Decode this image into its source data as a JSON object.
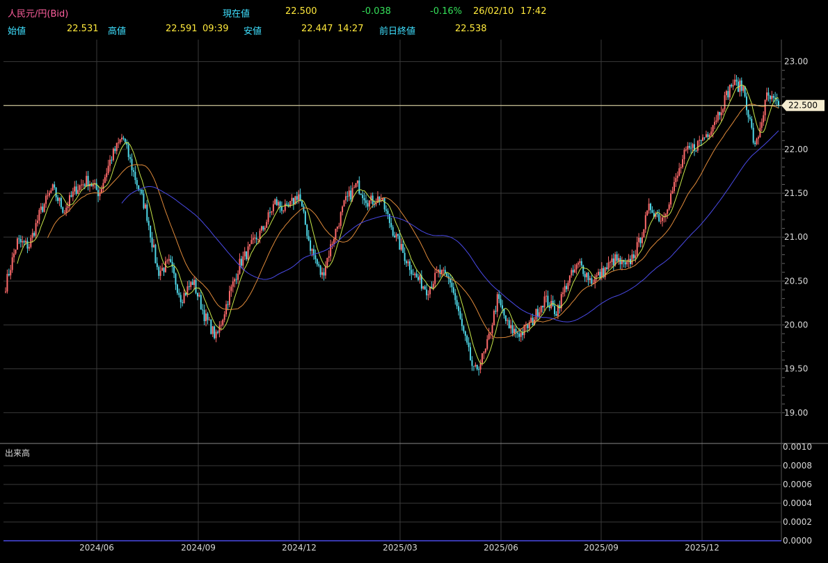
{
  "header": {
    "symbol": "人民元/円(Bid)",
    "current_label": "現在値",
    "current_value": "22.500",
    "change": "-0.038",
    "change_pct": "-0.16%",
    "date": "26/02/10",
    "time": "17:42",
    "open_label": "始値",
    "open_value": "22.531",
    "high_label": "高値",
    "high_value": "22.591",
    "high_time": "09:39",
    "low_label": "安値",
    "low_value": "22.447",
    "low_time": "14:27",
    "prev_close_label": "前日終値",
    "prev_close_value": "22.538"
  },
  "colors": {
    "background": "#000000",
    "grid": "#3a3a3a",
    "up_candle": "#ff6b6b",
    "down_candle": "#4fd8e8",
    "ma_short": "#c8e84a",
    "ma_mid": "#e08a3a",
    "ma_long": "#4a4ae8",
    "price_line": "#f0e6b0"
  },
  "chart_data": {
    "type": "candlestick",
    "price_axis": {
      "ticks": [
        "23.00",
        "22.50",
        "22.00",
        "21.50",
        "21.00",
        "20.50",
        "20.00",
        "19.50",
        "19.00"
      ],
      "ylim": [
        18.65,
        23.25
      ]
    },
    "current_price_marker": "22.500",
    "x_ticks": [
      "2024/06",
      "2024/09",
      "2024/12",
      "2025/03",
      "2025/06",
      "2025/09",
      "2025/12"
    ],
    "close_path": [
      [
        "2024-04",
        20.45
      ],
      [
        "2024-04",
        20.95
      ],
      [
        "2024-05",
        20.9
      ],
      [
        "2024-05",
        21.3
      ],
      [
        "2024-05",
        21.55
      ],
      [
        "2024-06",
        21.3
      ],
      [
        "2024-06",
        21.55
      ],
      [
        "2024-06",
        21.65
      ],
      [
        "2024-07",
        21.5
      ],
      [
        "2024-07",
        21.9
      ],
      [
        "2024-07",
        22.15
      ],
      [
        "2024-07",
        21.7
      ],
      [
        "2024-08",
        21.3
      ],
      [
        "2024-08",
        20.6
      ],
      [
        "2024-08",
        20.7
      ],
      [
        "2024-08",
        20.3
      ],
      [
        "2024-09",
        20.5
      ],
      [
        "2024-09",
        20.1
      ],
      [
        "2024-09",
        19.85
      ],
      [
        "2024-09",
        20.3
      ],
      [
        "2024-10",
        20.7
      ],
      [
        "2024-10",
        20.9
      ],
      [
        "2024-10",
        21.1
      ],
      [
        "2024-11",
        21.4
      ],
      [
        "2024-11",
        21.3
      ],
      [
        "2024-11",
        21.5
      ],
      [
        "2024-12",
        20.9
      ],
      [
        "2024-12",
        20.55
      ],
      [
        "2024-12",
        21.0
      ],
      [
        "2025-01",
        21.4
      ],
      [
        "2025-01",
        21.6
      ],
      [
        "2025-01",
        21.4
      ],
      [
        "2025-02",
        21.45
      ],
      [
        "2025-02",
        21.1
      ],
      [
        "2025-02",
        20.8
      ],
      [
        "2025-03",
        20.55
      ],
      [
        "2025-03",
        20.4
      ],
      [
        "2025-03",
        20.6
      ],
      [
        "2025-04",
        20.5
      ],
      [
        "2025-04",
        19.95
      ],
      [
        "2025-04",
        19.45
      ],
      [
        "2025-05",
        19.7
      ],
      [
        "2025-05",
        20.3
      ],
      [
        "2025-05",
        19.95
      ],
      [
        "2025-06",
        19.9
      ],
      [
        "2025-06",
        20.05
      ],
      [
        "2025-06",
        20.3
      ],
      [
        "2025-07",
        20.15
      ],
      [
        "2025-07",
        20.5
      ],
      [
        "2025-07",
        20.7
      ],
      [
        "2025-08",
        20.5
      ],
      [
        "2025-08",
        20.6
      ],
      [
        "2025-09",
        20.75
      ],
      [
        "2025-09",
        20.65
      ],
      [
        "2025-10",
        20.9
      ],
      [
        "2025-10",
        21.35
      ],
      [
        "2025-10",
        21.2
      ],
      [
        "2025-11",
        21.55
      ],
      [
        "2025-11",
        21.95
      ],
      [
        "2025-11",
        22.05
      ],
      [
        "2025-12",
        22.2
      ],
      [
        "2025-12",
        22.45
      ],
      [
        "2026-01",
        22.75
      ],
      [
        "2026-01",
        22.7
      ],
      [
        "2026-01",
        22.0
      ],
      [
        "2026-02",
        22.6
      ],
      [
        "2026-02",
        22.5
      ]
    ],
    "volume_axis": {
      "label": "出来高",
      "ticks": [
        "0.0010",
        "0.0008",
        "0.0006",
        "0.0004",
        "0.0002",
        "0.0000"
      ]
    }
  }
}
